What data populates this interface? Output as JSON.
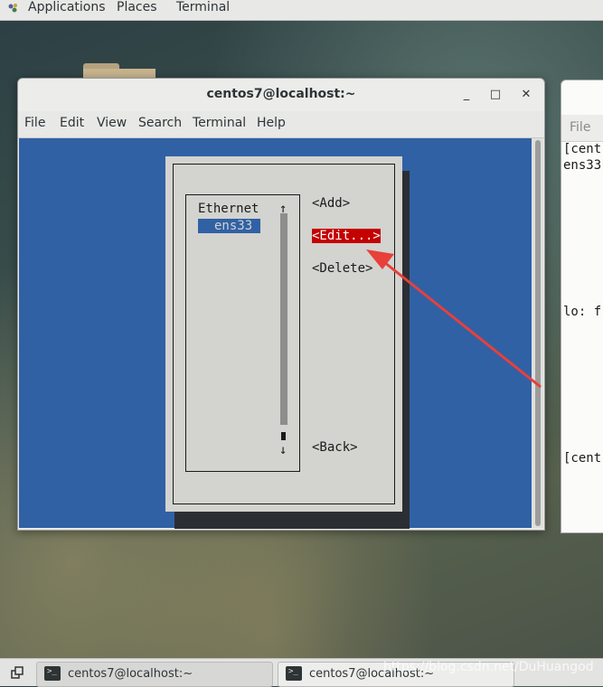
{
  "topbar": {
    "applications": "Applications",
    "places": "Places",
    "terminal": "Terminal"
  },
  "window": {
    "title": "centos7@localhost:~",
    "minimize": "_",
    "maximize": "□",
    "close": "✕",
    "menu": [
      "File",
      "Edit",
      "View",
      "Search",
      "Terminal",
      "Help"
    ]
  },
  "nmtui": {
    "list_header": "Ethernet",
    "selected_connection": "ens33",
    "scroll_up": "↑",
    "scroll_down": "↓",
    "add": "<Add>",
    "edit": "<Edit...>",
    "delete": "<Delete>",
    "back": "<Back>"
  },
  "background_window": {
    "menu_file": "File",
    "lines": [
      "[cent",
      "ens33",
      "lo: f",
      "[cent"
    ]
  },
  "taskbar": {
    "items": [
      {
        "label": "centos7@localhost:~"
      },
      {
        "label": "centos7@localhost:~"
      }
    ]
  },
  "watermark": "https://blog.csdn.net/DuHuangod",
  "colors": {
    "terminal_bg": "#3061a5",
    "dialog_bg": "#d3d3cf",
    "highlight": "#c40000",
    "arrow": "#e8403a"
  }
}
